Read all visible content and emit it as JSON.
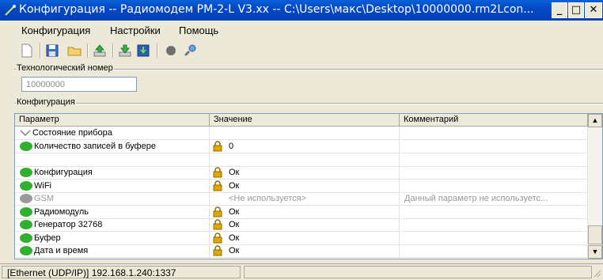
{
  "window": {
    "title": "Конфигурация -- Радиомодем РМ-2-L V3.xx -- C:\\Users\\макс\\Desktop\\10000000.rm2Lcon...",
    "minimize_glyph": "_",
    "maximize_glyph": "□",
    "close_glyph": "✕"
  },
  "menu": {
    "items": [
      "Конфигурация",
      "Настройки",
      "Помощь"
    ]
  },
  "toolbar": {
    "buttons": [
      "new-document-icon",
      "save-icon",
      "open-folder-icon",
      "upload-icon",
      "download-icon",
      "import-icon",
      "record-icon",
      "connect-icon"
    ]
  },
  "tech_number": {
    "legend": "Технологический номер",
    "value": "10000000"
  },
  "config": {
    "legend": "Конфигурация",
    "columns": [
      "Параметр",
      "Значение",
      "Комментарий"
    ],
    "group_label": "Состояние прибора",
    "rows": [
      {
        "param": "Количество записей в буфере",
        "value": "0",
        "comment": "",
        "status": "green",
        "locked": true
      },
      {
        "param": "",
        "value": "",
        "comment": "",
        "status": "",
        "locked": false
      },
      {
        "param": "Конфигурация",
        "value": "Ок",
        "comment": "",
        "status": "green",
        "locked": true
      },
      {
        "param": "WiFi",
        "value": "Ок",
        "comment": "",
        "status": "green",
        "locked": true
      },
      {
        "param": "GSM",
        "value": "<Не используется>",
        "comment": "Данный параметр не используетс...",
        "status": "gray",
        "locked": false
      },
      {
        "param": "Радиомодуль",
        "value": "Ок",
        "comment": "",
        "status": "green",
        "locked": true
      },
      {
        "param": "Генератор 32768",
        "value": "Ок",
        "comment": "",
        "status": "green",
        "locked": true
      },
      {
        "param": "Буфер",
        "value": "Ок",
        "comment": "",
        "status": "green",
        "locked": true
      },
      {
        "param": "Дата и время",
        "value": "Ок",
        "comment": "",
        "status": "green",
        "locked": true
      }
    ]
  },
  "statusbar": {
    "connection": "[Ethernet (UDP/IP)] 192.168.1.240:1337"
  },
  "colors": {
    "title_bar": "#0348c4",
    "status_green": "#2fb02f",
    "status_gray": "#9a9a9a",
    "lock": "#e0a800"
  }
}
